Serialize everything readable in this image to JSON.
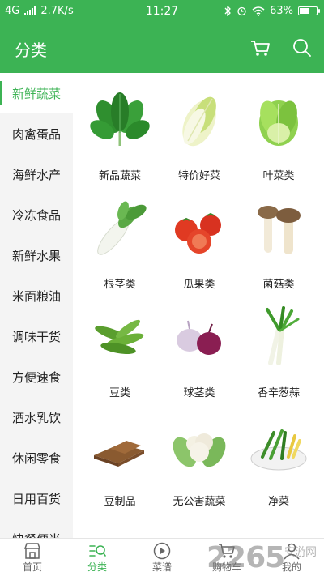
{
  "status_bar": {
    "network": "4G",
    "speed": "2.7K/s",
    "time": "11:27",
    "battery": "63%",
    "battery_level": 0.63
  },
  "header": {
    "title": "分类",
    "cart_icon": "cart-icon",
    "search_icon": "search-icon"
  },
  "sidebar": {
    "items": [
      {
        "label": "新鲜蔬菜",
        "active": true
      },
      {
        "label": "肉禽蛋品"
      },
      {
        "label": "海鲜水产"
      },
      {
        "label": "冷冻食品"
      },
      {
        "label": "新鲜水果"
      },
      {
        "label": "米面粮油"
      },
      {
        "label": "调味干货"
      },
      {
        "label": "方便速食"
      },
      {
        "label": "酒水乳饮"
      },
      {
        "label": "休闲零食"
      },
      {
        "label": "日用百货"
      },
      {
        "label": "快餐便当"
      }
    ]
  },
  "categories": [
    {
      "label": "新品蔬菜",
      "image": "spinach"
    },
    {
      "label": "特价好菜",
      "image": "napa-cabbage"
    },
    {
      "label": "叶菜类",
      "image": "lettuce"
    },
    {
      "label": "根茎类",
      "image": "radish"
    },
    {
      "label": "瓜果类",
      "image": "tomato"
    },
    {
      "label": "菌菇类",
      "image": "king-oyster-mushroom"
    },
    {
      "label": "豆类",
      "image": "edamame"
    },
    {
      "label": "球茎类",
      "image": "onion"
    },
    {
      "label": "香辛葱蒜",
      "image": "scallion"
    },
    {
      "label": "豆制品",
      "image": "dried-tofu"
    },
    {
      "label": "无公害蔬菜",
      "image": "cauliflower"
    },
    {
      "label": "净菜",
      "image": "vegetable-platter"
    }
  ],
  "bottom_nav": [
    {
      "label": "首页",
      "icon": "shop-icon"
    },
    {
      "label": "分类",
      "icon": "category-icon",
      "active": true
    },
    {
      "label": "菜谱",
      "icon": "play-icon"
    },
    {
      "label": "购物车",
      "icon": "cart-icon"
    },
    {
      "label": "我的",
      "icon": "user-icon"
    }
  ],
  "watermark": {
    "text": "2265",
    "sub": "安游网"
  },
  "colors": {
    "brand": "#3cb354",
    "sidebar_bg": "#f4f4f4",
    "text": "#222222"
  }
}
